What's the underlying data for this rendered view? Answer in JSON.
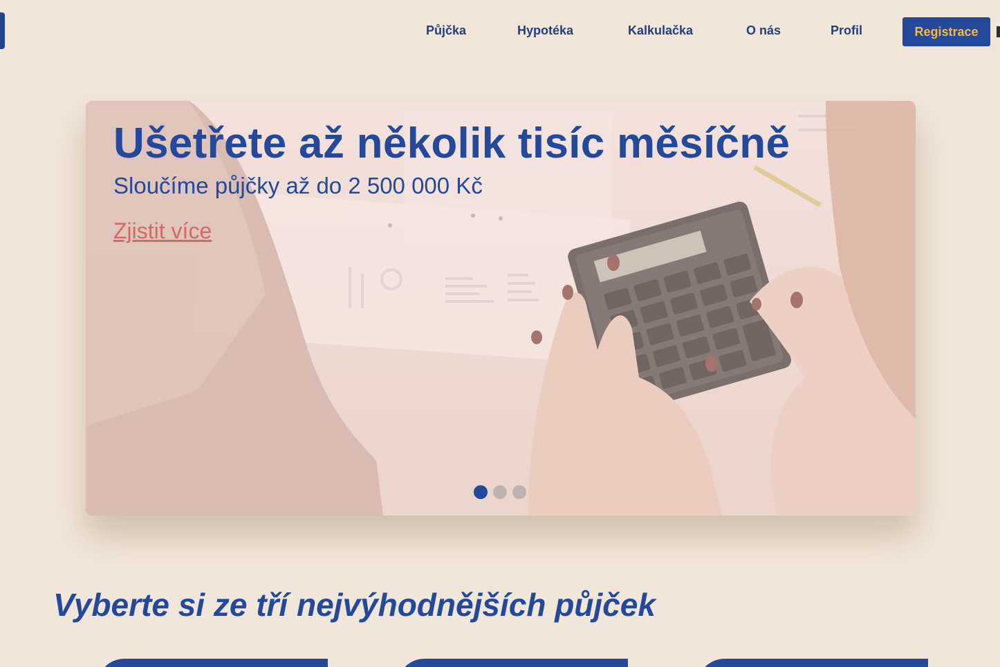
{
  "nav": {
    "links": [
      "Půjčka",
      "Hypotéka",
      "Kalkulačka",
      "O nás",
      "Profil"
    ],
    "register_label": "Registrace"
  },
  "hero": {
    "title": "Ušetřete až několik tisíc měsíčně",
    "subtitle": "Sloučíme půjčky až do 2 500 000 Kč",
    "link_label": "Zjistit více",
    "slides_total": 3,
    "active_slide": 1
  },
  "section": {
    "title": "Vyberte si ze tří nejvýhodnějších půjček"
  },
  "colors": {
    "background": "#f1e6da",
    "brand_blue": "#24489a",
    "accent_gold": "#f5b93f",
    "link_red": "#d36a6a"
  }
}
